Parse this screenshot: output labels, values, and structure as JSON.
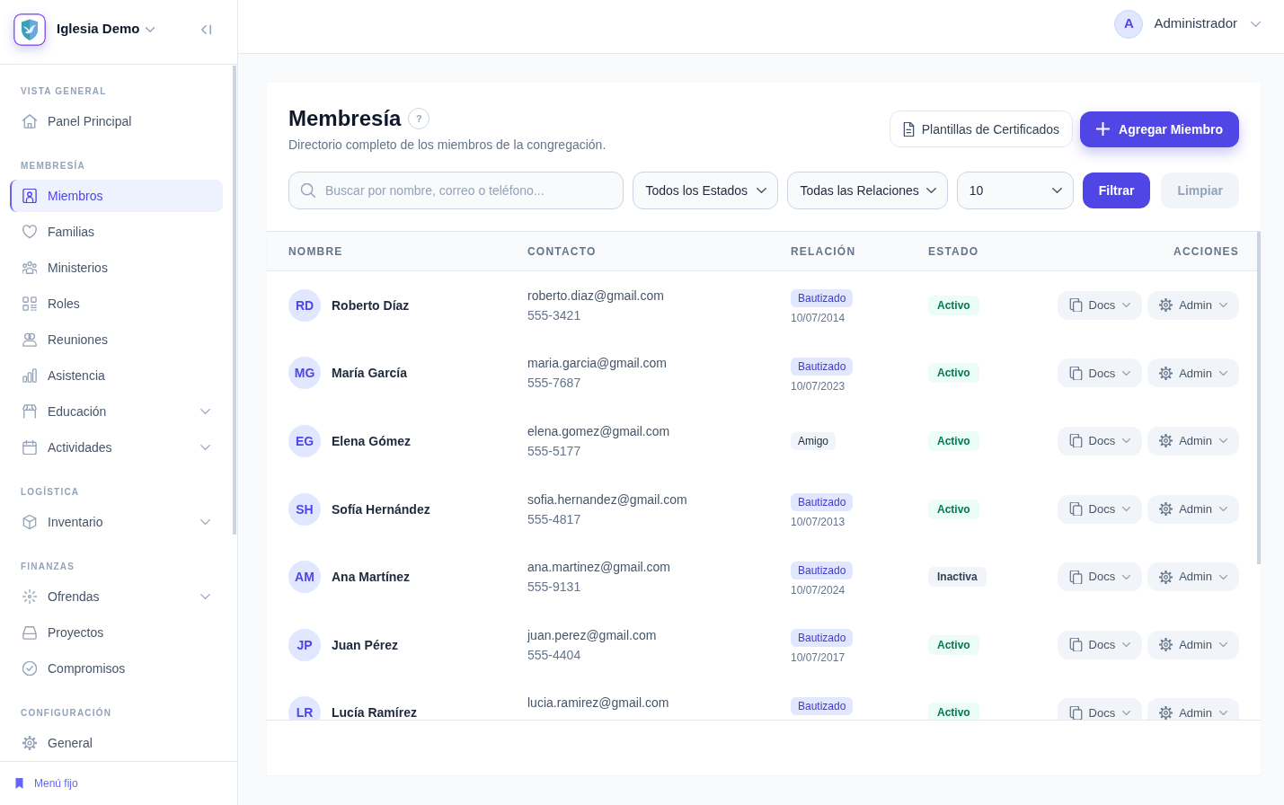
{
  "sidebar": {
    "org": {
      "name": "Iglesia Demo"
    },
    "sections": [
      {
        "label": "VISTA GENERAL",
        "items": [
          {
            "label": "Panel Principal",
            "kind": "link",
            "selected": false
          }
        ]
      },
      {
        "label": "MEMBRESÍA",
        "items": [
          {
            "label": "Miembros",
            "kind": "link",
            "selected": true
          },
          {
            "label": "Familias",
            "kind": "link",
            "selected": false
          },
          {
            "label": "Ministerios",
            "kind": "link",
            "selected": false
          },
          {
            "label": "Roles",
            "kind": "link",
            "selected": false
          },
          {
            "label": "Reuniones",
            "kind": "link",
            "selected": false
          },
          {
            "label": "Asistencia",
            "kind": "link",
            "selected": false
          },
          {
            "label": "Educación",
            "kind": "group",
            "selected": false,
            "expanded": false
          },
          {
            "label": "Actividades",
            "kind": "group",
            "selected": false,
            "expanded": false
          }
        ]
      },
      {
        "label": "LOGÍSTICA",
        "items": [
          {
            "label": "Inventario",
            "kind": "group",
            "selected": false,
            "expanded": false
          }
        ]
      },
      {
        "label": "FINANZAS",
        "items": [
          {
            "label": "Ofrendas",
            "kind": "group",
            "selected": false,
            "expanded": false
          },
          {
            "label": "Proyectos",
            "kind": "link",
            "selected": false
          },
          {
            "label": "Compromisos",
            "kind": "link",
            "selected": false
          }
        ]
      },
      {
        "label": "CONFIGURACIÓN",
        "items": [
          {
            "label": "General",
            "kind": "link",
            "selected": false
          }
        ]
      }
    ],
    "footer": {
      "label": "Menú fijo"
    }
  },
  "top_bar": {
    "user": {
      "initial": "A",
      "name": "Administrador"
    }
  },
  "page": {
    "title": "Membresía",
    "help": "?",
    "subtitle": "Directorio completo de los miembros de la congregación.",
    "actions": [
      {
        "label": "Plantillas de Certificados",
        "kind": "secondary"
      },
      {
        "label": "Agregar Miembro",
        "kind": "primary"
      }
    ]
  },
  "filters": {
    "search": {
      "placeholder": "Buscar por nombre, correo o teléfono..."
    },
    "selects": [
      {
        "value": "Todos los Estados"
      },
      {
        "value": "Todas las Relaciones"
      },
      {
        "value": "10"
      }
    ],
    "buttons": [
      {
        "label": "Filtrar",
        "kind": "primary",
        "disabled": false
      },
      {
        "label": "Limpiar",
        "kind": "secondary",
        "disabled": true
      }
    ]
  },
  "table": {
    "columns": [
      "NOMBRE",
      "CONTACTO",
      "RELACIÓN",
      "ESTADO",
      "ACCIONES"
    ],
    "rows": [
      {
        "initials": "RD",
        "name": "Roberto Díaz",
        "email": "roberto.diaz@gmail.com",
        "phone": "555-3421",
        "relation": {
          "label": "Bautizado",
          "kind": "baptized",
          "date": "10/07/2014"
        },
        "status": {
          "label": "Activo",
          "active": true
        },
        "actions": [
          {
            "label": "Docs"
          },
          {
            "label": "Admin"
          }
        ]
      },
      {
        "initials": "MG",
        "name": "María García",
        "email": "maria.garcia@gmail.com",
        "phone": "555-7687",
        "relation": {
          "label": "Bautizado",
          "kind": "baptized",
          "date": "10/07/2023"
        },
        "status": {
          "label": "Activo",
          "active": true
        },
        "actions": [
          {
            "label": "Docs"
          },
          {
            "label": "Admin"
          }
        ]
      },
      {
        "initials": "EG",
        "name": "Elena Gómez",
        "email": "elena.gomez@gmail.com",
        "phone": "555-5177",
        "relation": {
          "label": "Amigo",
          "kind": "friend"
        },
        "status": {
          "label": "Activo",
          "active": true
        },
        "actions": [
          {
            "label": "Docs"
          },
          {
            "label": "Admin"
          }
        ]
      },
      {
        "initials": "SH",
        "name": "Sofía Hernández",
        "email": "sofia.hernandez@gmail.com",
        "phone": "555-4817",
        "relation": {
          "label": "Bautizado",
          "kind": "baptized",
          "date": "10/07/2013"
        },
        "status": {
          "label": "Activo",
          "active": true
        },
        "actions": [
          {
            "label": "Docs"
          },
          {
            "label": "Admin"
          }
        ]
      },
      {
        "initials": "AM",
        "name": "Ana Martínez",
        "email": "ana.martinez@gmail.com",
        "phone": "555-9131",
        "relation": {
          "label": "Bautizado",
          "kind": "baptized",
          "date": "10/07/2024"
        },
        "status": {
          "label": "Inactiva",
          "active": false
        },
        "actions": [
          {
            "label": "Docs"
          },
          {
            "label": "Admin"
          }
        ]
      },
      {
        "initials": "JP",
        "name": "Juan Pérez",
        "email": "juan.perez@gmail.com",
        "phone": "555-4404",
        "relation": {
          "label": "Bautizado",
          "kind": "baptized",
          "date": "10/07/2017"
        },
        "status": {
          "label": "Activo",
          "active": true
        },
        "actions": [
          {
            "label": "Docs"
          },
          {
            "label": "Admin"
          }
        ]
      },
      {
        "initials": "LR",
        "name": "Lucía Ramírez",
        "email": "lucia.ramirez@gmail.com",
        "relation": {
          "label": "Bautizado",
          "kind": "baptized"
        },
        "status": {
          "label": "Activo",
          "active": true
        },
        "actions": [
          {
            "label": "Docs"
          },
          {
            "label": "Admin"
          }
        ]
      }
    ]
  }
}
